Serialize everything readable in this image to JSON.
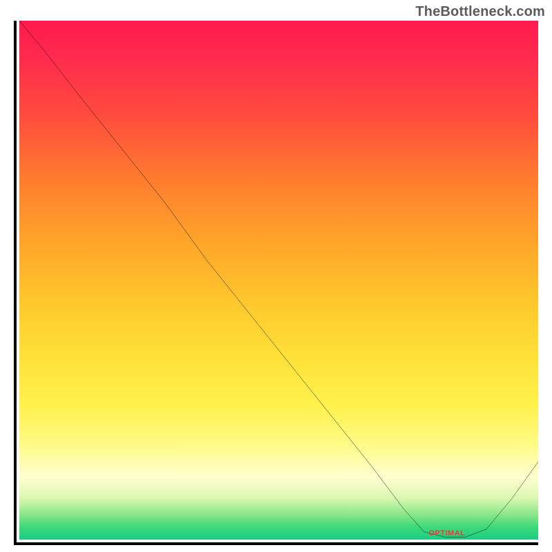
{
  "attribution": "TheBottleneck.com",
  "optimal_label": "OPTIMAL",
  "colors": {
    "top": "#ff1a4d",
    "bottom": "#18cf82",
    "curve": "#000000",
    "label": "#ff2b2b"
  },
  "chart_data": {
    "type": "line",
    "title": "",
    "xlabel": "",
    "ylabel": "",
    "xlim": [
      0,
      100
    ],
    "ylim": [
      0,
      100
    ],
    "series": [
      {
        "name": "bottleneck-curve",
        "x": [
          0,
          5,
          12,
          20,
          28,
          36,
          44,
          52,
          60,
          68,
          74,
          78,
          82,
          86,
          90,
          95,
          100
        ],
        "values": [
          100,
          94,
          85,
          75,
          65,
          54,
          44,
          34,
          24,
          14,
          6,
          1.5,
          0.5,
          0.5,
          2,
          8,
          15
        ]
      }
    ],
    "optimal_range_x": [
      78,
      87
    ],
    "optimal_label_pos": {
      "x_pct": 79,
      "y_pct": 97.5
    }
  }
}
